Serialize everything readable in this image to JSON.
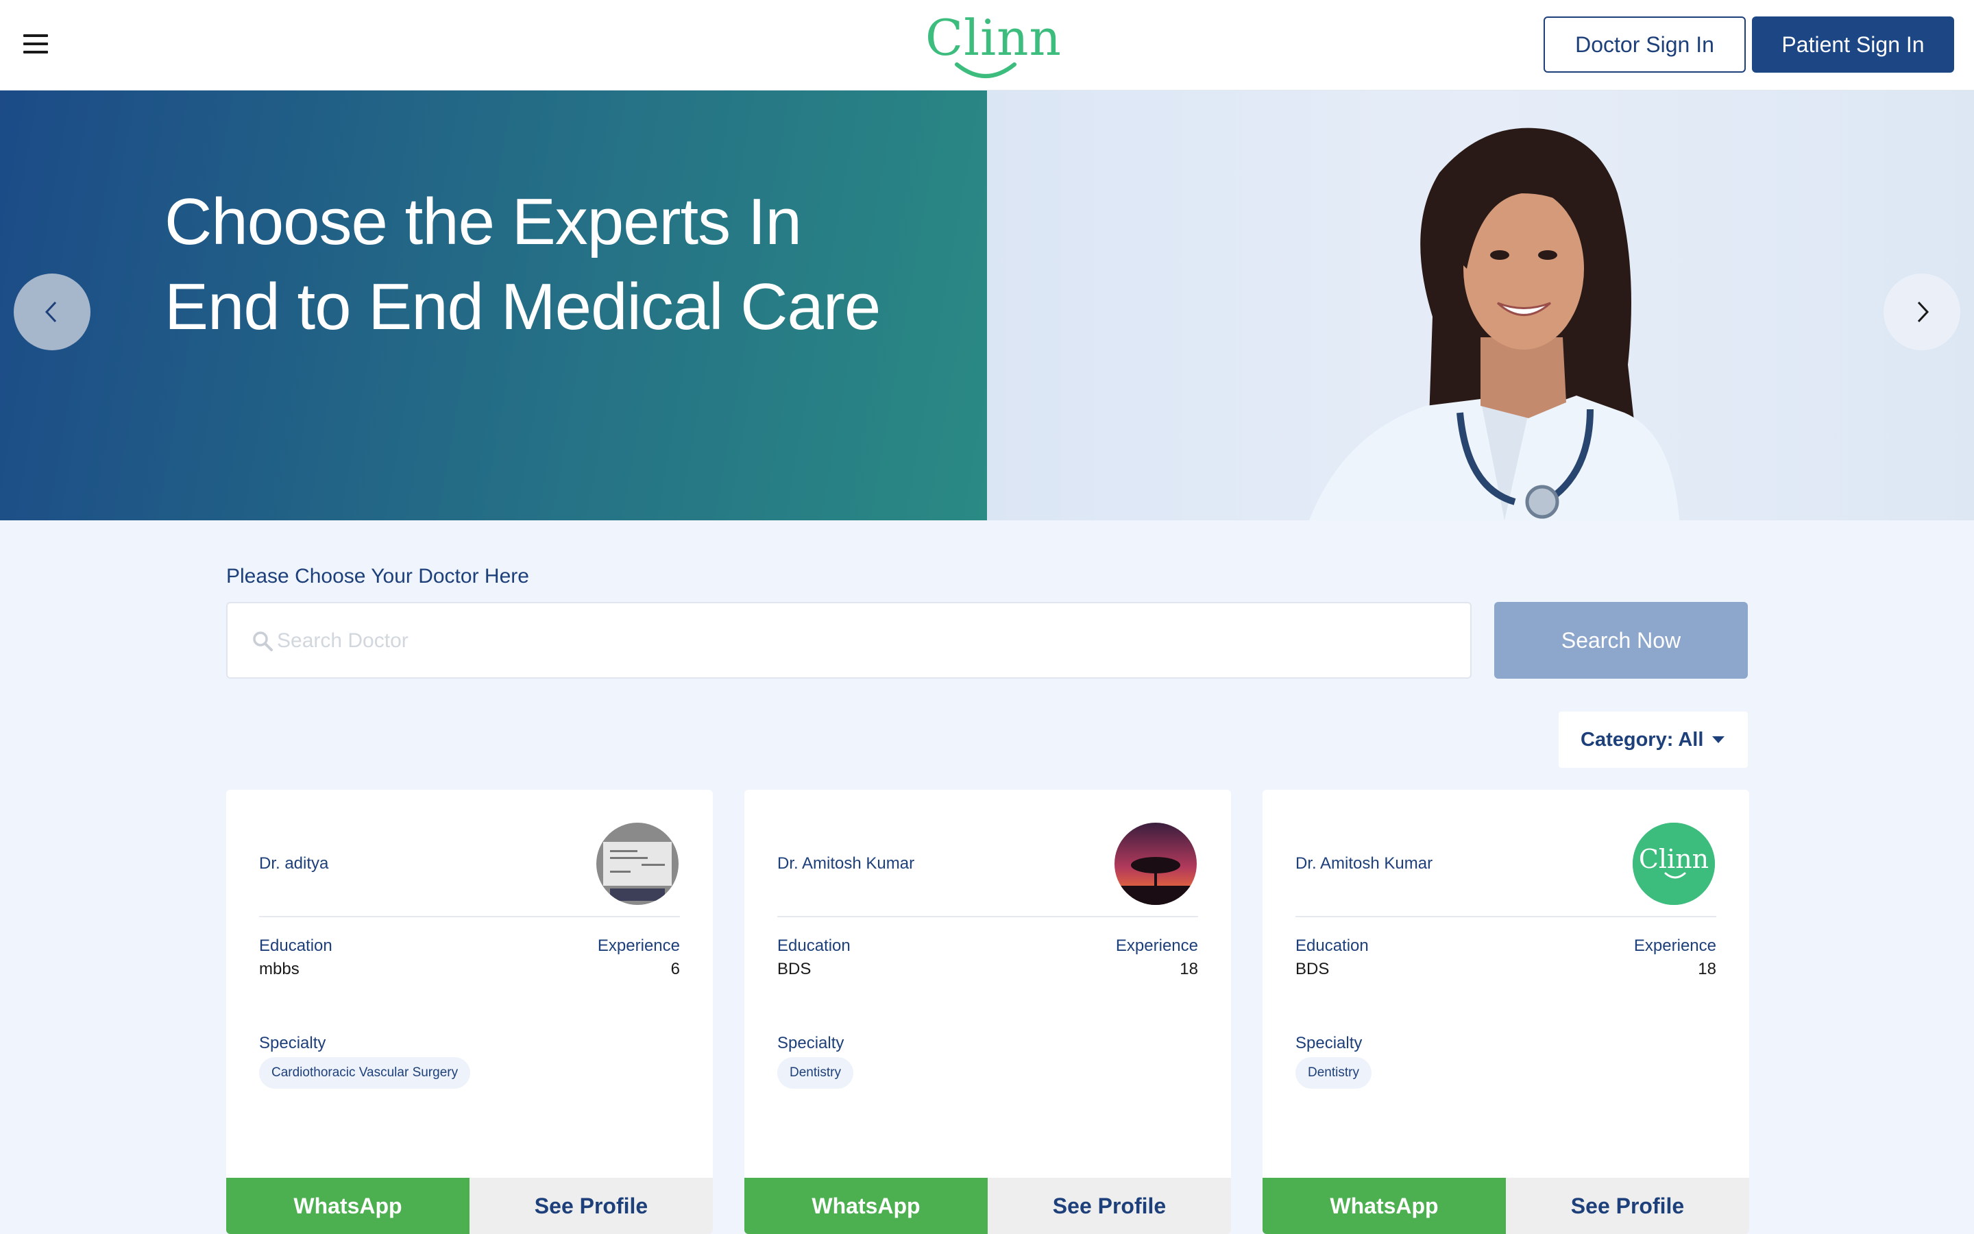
{
  "header": {
    "logo_text": "Clinn",
    "menu_icon": "hamburger-menu-icon",
    "doctor_sign_in": "Doctor Sign In",
    "patient_sign_in": "Patient Sign In"
  },
  "hero": {
    "title": "Choose the Experts In End to End Medical Care",
    "prev_icon": "chevron-left-icon",
    "next_icon": "chevron-right-icon"
  },
  "search": {
    "label": "Please Choose Your Doctor Here",
    "placeholder": "Search Doctor",
    "button": "Search Now"
  },
  "category": {
    "label": "Category: All"
  },
  "labels": {
    "education": "Education",
    "experience": "Experience",
    "specialty": "Specialty",
    "whatsapp": "WhatsApp",
    "see_profile": "See Profile"
  },
  "doctors": [
    {
      "name": "Dr. aditya",
      "education": "mbbs",
      "experience": "6",
      "specialty": "Cardiothoracic Vascular Surgery",
      "avatar": "photo-whiteboard"
    },
    {
      "name": "Dr. Amitosh Kumar",
      "education": "BDS",
      "experience": "18",
      "specialty": "Dentistry",
      "avatar": "photo-tree-sunset"
    },
    {
      "name": "Dr. Amitosh Kumar",
      "education": "BDS",
      "experience": "18",
      "specialty": "Dentistry",
      "avatar": "clinn-logo"
    }
  ],
  "colors": {
    "primary": "#1d4685",
    "brand_green": "#3dbd7d",
    "whatsapp_green": "#4caf50",
    "search_button": "#8da6cc",
    "page_background": "#f0f5fd"
  }
}
